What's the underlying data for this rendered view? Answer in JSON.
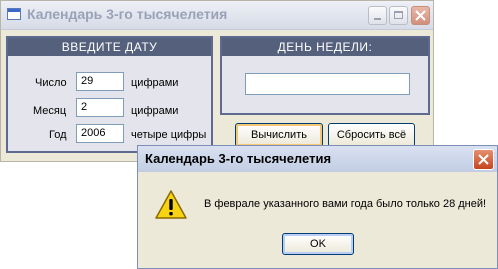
{
  "main_window": {
    "title": "Календарь 3-го тысячелетия",
    "date_panel": {
      "header": "ВВЕДИТЕ ДАТУ",
      "day_label": "Число",
      "day_value": "29",
      "day_hint": "цифрами",
      "month_label": "Месяц",
      "month_value": "2",
      "month_hint": "цифрами",
      "year_label": "Год",
      "year_value": "2006",
      "year_hint": "четыре цифры"
    },
    "weekday_panel": {
      "header": "ДЕНЬ НЕДЕЛИ:",
      "result_value": ""
    },
    "calculate_label": "Вычислить",
    "reset_label": "Сбросить всё"
  },
  "message_box": {
    "title": "Календарь 3-го тысячелетия",
    "message": "В феврале указанного вами года было только 28 дней!",
    "ok_label": "OK",
    "icon": "warning-icon"
  }
}
